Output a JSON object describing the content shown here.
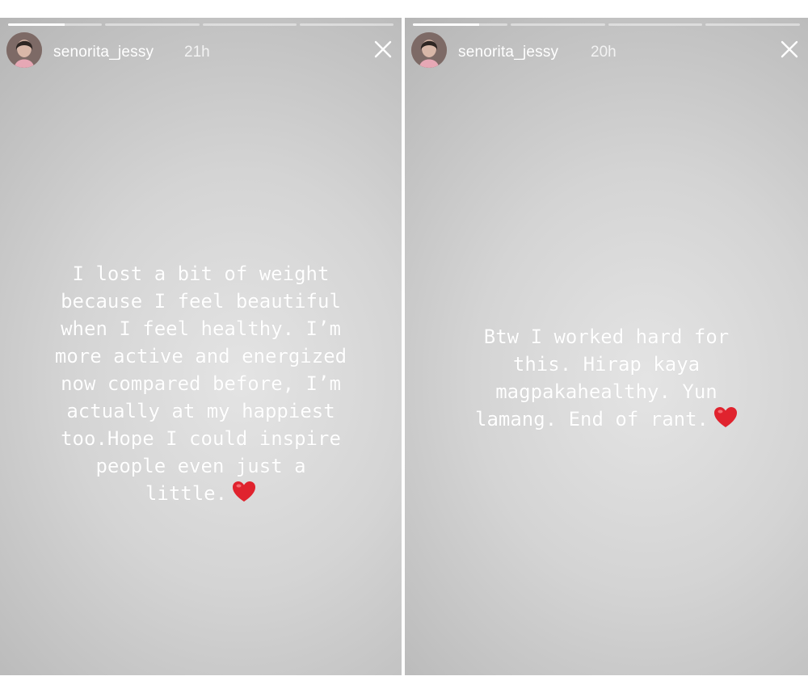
{
  "stories": [
    {
      "username": "senorita_jessy",
      "timestamp": "21h",
      "text": "I lost a bit of weight\nbecause I feel beautiful\nwhen I feel healthy. I’m\nmore active and energized\nnow compared before, I’m\nactually at my happiest\ntoo.Hope I could inspire\npeople even just a\nlittle.",
      "emoji": "heart-icon",
      "progress": [
        0.6,
        0,
        0,
        0
      ]
    },
    {
      "username": "senorita_jessy",
      "timestamp": "20h",
      "text": "Btw I worked hard for\nthis. Hirap kaya\nmagpakahealthy. Yun\nlamang. End of rant.",
      "emoji": "heart-icon",
      "progress": [
        0.7,
        0,
        0,
        0
      ]
    }
  ],
  "colors": {
    "heart": "#e0232e",
    "text": "#ffffff"
  },
  "icons": {
    "close": "close-icon",
    "avatar": "avatar"
  }
}
